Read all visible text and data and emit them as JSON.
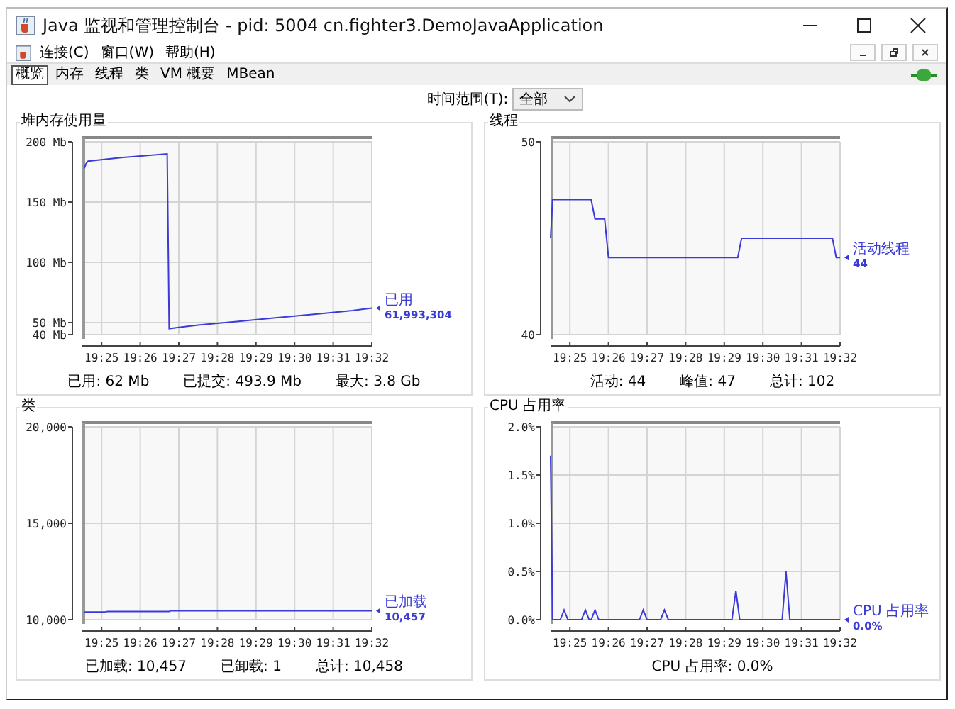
{
  "window": {
    "title": "Java 监视和管理控制台 - pid: 5004 cn.fighter3.DemoJavaApplication"
  },
  "menu": [
    "连接(C)",
    "窗口(W)",
    "帮助(H)"
  ],
  "tabs": [
    {
      "label": "概览",
      "selected": true
    },
    {
      "label": "内存",
      "selected": false
    },
    {
      "label": "线程",
      "selected": false
    },
    {
      "label": "类",
      "selected": false
    },
    {
      "label": "VM 概要",
      "selected": false
    },
    {
      "label": "MBean",
      "selected": false
    }
  ],
  "time_range": {
    "label": "时间范围(T):",
    "value": "全部"
  },
  "panels": [
    {
      "title": "堆内存使用量",
      "current_value": "61,993,304",
      "stats": [
        "已用:  62  Mb",
        "已提交:  493.9  Mb",
        "最大:  3.8  Gb"
      ],
      "chart_data": {
        "type": "line",
        "grid": true,
        "xlim": [
          1164.5,
          1172
        ],
        "ylim": [
          40,
          200
        ],
        "xticks": [
          {
            "value": 1165,
            "label": "19:25"
          },
          {
            "value": 1166,
            "label": "19:26"
          },
          {
            "value": 1167,
            "label": "19:27"
          },
          {
            "value": 1168,
            "label": "19:28"
          },
          {
            "value": 1169,
            "label": "19:29"
          },
          {
            "value": 1170,
            "label": "19:30"
          },
          {
            "value": 1171,
            "label": "19:31"
          },
          {
            "value": 1172,
            "label": "19:32"
          }
        ],
        "yticks": [
          {
            "value": 40,
            "label": "40 Mb"
          },
          {
            "value": 50,
            "label": "50 Mb"
          },
          {
            "value": 100,
            "label": "100 Mb"
          },
          {
            "value": 150,
            "label": "150 Mb"
          },
          {
            "value": 200,
            "label": "200 Mb"
          }
        ],
        "x": [
          1164.55,
          1164.6,
          1164.65,
          1165.5,
          1166.7,
          1166.75,
          1167.5,
          1168.5,
          1169.5,
          1170.5,
          1171.5,
          1172
        ],
        "series": [
          {
            "name": "已用",
            "color": "#3a3ad6",
            "values": [
              178,
              182,
              184,
              187,
              190,
              45,
              48,
              51,
              54,
              57,
              60,
              62
            ]
          }
        ]
      }
    },
    {
      "title": "线程",
      "current_value": "44",
      "stats": [
        "活动:  44",
        "峰值:  47",
        "总计:  102"
      ],
      "chart_data": {
        "type": "line",
        "grid": true,
        "xlim": [
          1164.5,
          1172
        ],
        "ylim": [
          40,
          50
        ],
        "xticks": [
          {
            "value": 1165,
            "label": "19:25"
          },
          {
            "value": 1166,
            "label": "19:26"
          },
          {
            "value": 1167,
            "label": "19:27"
          },
          {
            "value": 1168,
            "label": "19:28"
          },
          {
            "value": 1169,
            "label": "19:29"
          },
          {
            "value": 1170,
            "label": "19:30"
          },
          {
            "value": 1171,
            "label": "19:31"
          },
          {
            "value": 1172,
            "label": "19:32"
          }
        ],
        "yticks": [
          40,
          50
        ],
        "x": [
          1164.5,
          1164.55,
          1165.55,
          1165.65,
          1165.9,
          1166.0,
          1169.35,
          1169.45,
          1171.8,
          1171.9,
          1172
        ],
        "series": [
          {
            "name": "活动线程",
            "color": "#3a3ad6",
            "values": [
              45,
              47,
              47,
              46,
              46,
              44,
              44,
              45,
              45,
              44,
              44
            ]
          }
        ]
      }
    },
    {
      "title": "类",
      "current_value": "10,457",
      "stats": [
        "已加载:  10,457",
        "已卸载:  1",
        "总计:  10,458"
      ],
      "chart_data": {
        "type": "line",
        "grid": true,
        "xlim": [
          1164.5,
          1172
        ],
        "ylim": [
          10000,
          20000
        ],
        "xticks": [
          {
            "value": 1165,
            "label": "19:25"
          },
          {
            "value": 1166,
            "label": "19:26"
          },
          {
            "value": 1167,
            "label": "19:27"
          },
          {
            "value": 1168,
            "label": "19:28"
          },
          {
            "value": 1169,
            "label": "19:29"
          },
          {
            "value": 1170,
            "label": "19:30"
          },
          {
            "value": 1171,
            "label": "19:31"
          },
          {
            "value": 1172,
            "label": "19:32"
          }
        ],
        "yticks": [
          {
            "value": 10000,
            "label": "10,000"
          },
          {
            "value": 15000,
            "label": "15,000"
          },
          {
            "value": 20000,
            "label": "20,000"
          }
        ],
        "x": [
          1164.55,
          1165.1,
          1165.15,
          1166.75,
          1166.8,
          1172
        ],
        "series": [
          {
            "name": "已加载",
            "color": "#3a3ad6",
            "values": [
              10400,
              10400,
              10430,
              10430,
              10460,
              10460
            ]
          }
        ]
      }
    },
    {
      "title": "CPU 占用率",
      "current_value": "0.0%",
      "stats": [
        "CPU 占用率:  0.0%"
      ],
      "chart_data": {
        "type": "line",
        "grid": true,
        "xlim": [
          1164.5,
          1172
        ],
        "ylim": [
          0,
          2
        ],
        "xticks": [
          {
            "value": 1165,
            "label": "19:25"
          },
          {
            "value": 1166,
            "label": "19:26"
          },
          {
            "value": 1167,
            "label": "19:27"
          },
          {
            "value": 1168,
            "label": "19:28"
          },
          {
            "value": 1169,
            "label": "19:29"
          },
          {
            "value": 1170,
            "label": "19:30"
          },
          {
            "value": 1171,
            "label": "19:31"
          },
          {
            "value": 1172,
            "label": "19:32"
          }
        ],
        "yticks": [
          {
            "value": 0,
            "label": "0.0%"
          },
          {
            "value": 0.5,
            "label": "0.5%"
          },
          {
            "value": 1,
            "label": "1.0%"
          },
          {
            "value": 1.5,
            "label": "1.5%"
          },
          {
            "value": 2,
            "label": "2.0%"
          }
        ],
        "x": [
          1164.5,
          1164.55,
          1164.75,
          1164.85,
          1164.95,
          1165.3,
          1165.4,
          1165.5,
          1165.55,
          1165.65,
          1165.75,
          1166.8,
          1166.9,
          1167.0,
          1167.35,
          1167.45,
          1167.55,
          1169.2,
          1169.3,
          1169.4,
          1170.5,
          1170.6,
          1170.7,
          1172
        ],
        "series": [
          {
            "name": "CPU 占用率",
            "color": "#3a3ad6",
            "values": [
              1.7,
              0,
              0,
              0.1,
              0,
              0,
              0.1,
              0,
              0,
              0.1,
              0,
              0,
              0.1,
              0,
              0,
              0.1,
              0,
              0,
              0.3,
              0,
              0,
              0.5,
              0,
              0
            ]
          }
        ]
      }
    }
  ]
}
